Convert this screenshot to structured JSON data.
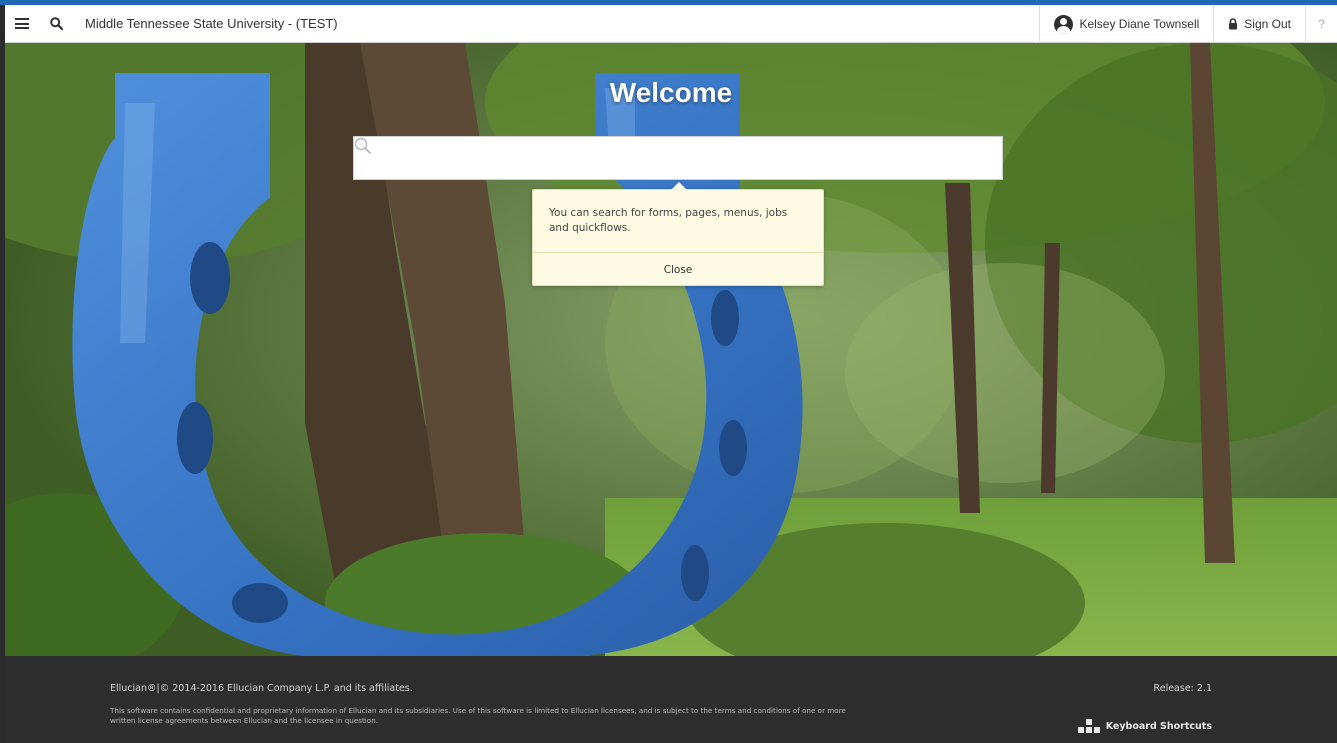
{
  "header": {
    "menu_icon": "hamburger-menu-icon",
    "search_icon": "search-icon",
    "org_title": "Middle Tennessee State University - (TEST)",
    "user_name": "Kelsey Diane Townsell",
    "user_icon": "user-avatar-icon",
    "sign_out_label": "Sign Out",
    "sign_out_icon": "lock-icon",
    "help_label": "?"
  },
  "main": {
    "welcome": "Welcome",
    "search": {
      "value": "",
      "placeholder": ""
    },
    "tooltip": {
      "text": "You can search for forms, pages, menus, jobs and quickflows.",
      "close_label": "Close"
    }
  },
  "footer": {
    "copyright": "Ellucian®|© 2014-2016 Ellucian Company L.P. and its affiliates.",
    "legal": "This software contains confidential and proprietary information of Ellucian and its subsidiaries. Use of this software is limited to Ellucian licensees, and is subject to the terms and conditions of one or more written license agreements between Ellucian and the licensee in question.",
    "release": "Release: 2.1",
    "keyboard_shortcuts": "Keyboard Shortcuts"
  },
  "colors": {
    "accent": "#1f68b3",
    "footer_bg": "#2e2e2e",
    "tooltip_bg": "#fdfbe3",
    "horseshoe": "#3f7fcf"
  }
}
